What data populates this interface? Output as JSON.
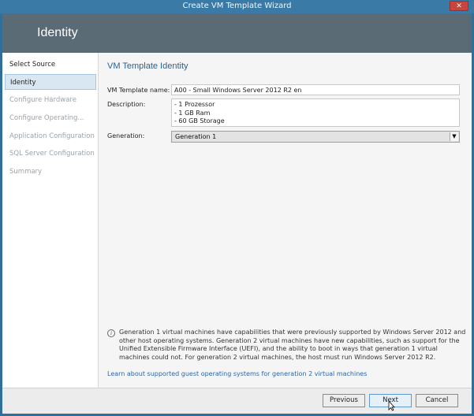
{
  "window": {
    "title": "Create VM Template Wizard",
    "close_glyph": "✕"
  },
  "header": {
    "title": "Identity"
  },
  "sidebar": {
    "items": [
      {
        "label": "Select Source",
        "state": "done"
      },
      {
        "label": "Identity",
        "state": "active"
      },
      {
        "label": "Configure Hardware",
        "state": "pending"
      },
      {
        "label": "Configure Operating...",
        "state": "pending"
      },
      {
        "label": "Application Configuration",
        "state": "pending"
      },
      {
        "label": "SQL Server Configuration",
        "state": "pending"
      },
      {
        "label": "Summary",
        "state": "pending"
      }
    ]
  },
  "main": {
    "section_title": "VM Template Identity",
    "name_label": "VM Template name:",
    "name_value": "A00 - Small Windows Server 2012 R2 en",
    "description_label": "Description:",
    "description_lines": [
      "- 1 Prozessor",
      "- 1 GB Ram",
      "- 60 GB Storage"
    ],
    "generation_label": "Generation:",
    "generation_value": "Generation 1",
    "info_icon": "info-icon",
    "info_text": "Generation 1 virtual machines have capabilities that were previously supported by Windows Server 2012 and other host operating systems. Generation 2 virtual machines have new capabilities, such as support for the Unified Extensible Firmware Interface (UEFI), and the ability to boot in ways that generation 1 virtual machines could not. For generation 2 virtual machines, the host must run Windows Server 2012 R2.",
    "info_link": "Learn about supported guest operating systems for generation 2 virtual machines"
  },
  "footer": {
    "previous_label": "Previous",
    "next_label": "Next",
    "cancel_label": "Cancel"
  },
  "colors": {
    "title_bar": "#3a7aa6",
    "header_band": "#5b6b76",
    "accent_text": "#2d5f8a",
    "link": "#2a67a8"
  }
}
